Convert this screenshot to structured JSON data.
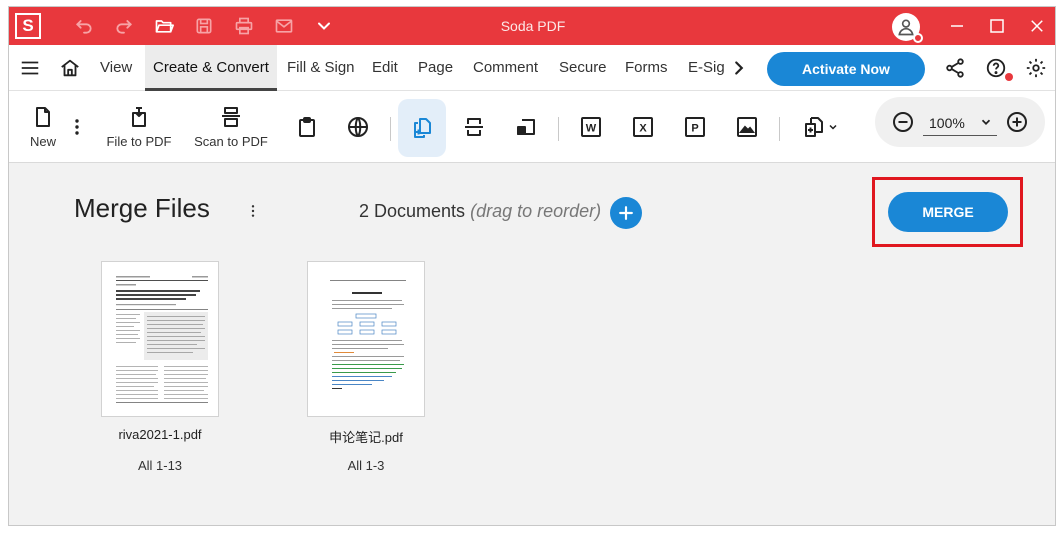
{
  "app": {
    "logo_letter": "S",
    "title": "Soda PDF"
  },
  "menubar": {
    "items": [
      {
        "label": "View"
      },
      {
        "label": "Create & Convert",
        "active": true
      },
      {
        "label": "Fill & Sign"
      },
      {
        "label": "Edit"
      },
      {
        "label": "Page"
      },
      {
        "label": "Comment"
      },
      {
        "label": "Secure"
      },
      {
        "label": "Forms"
      },
      {
        "label": "E-Sig"
      }
    ],
    "activate_label": "Activate Now"
  },
  "toolbar": {
    "new_label": "New",
    "file_to_pdf_label": "File to PDF",
    "scan_to_pdf_label": "Scan to PDF",
    "word_icon_letter": "W",
    "excel_icon_letter": "X",
    "ppt_icon_letter": "P",
    "zoom_value": "100%"
  },
  "merge": {
    "title": "Merge Files",
    "docs_count": "2 Documents",
    "docs_hint": "(drag to reorder)",
    "merge_label": "MERGE",
    "documents": [
      {
        "name": "riva2021-1.pdf",
        "pages": "All 1-13"
      },
      {
        "name": "申论笔记.pdf",
        "pages": "All 1-3"
      }
    ]
  },
  "colors": {
    "brand_red": "#e8383d",
    "accent_blue": "#1a87d6",
    "highlight_red": "#e0171f"
  }
}
